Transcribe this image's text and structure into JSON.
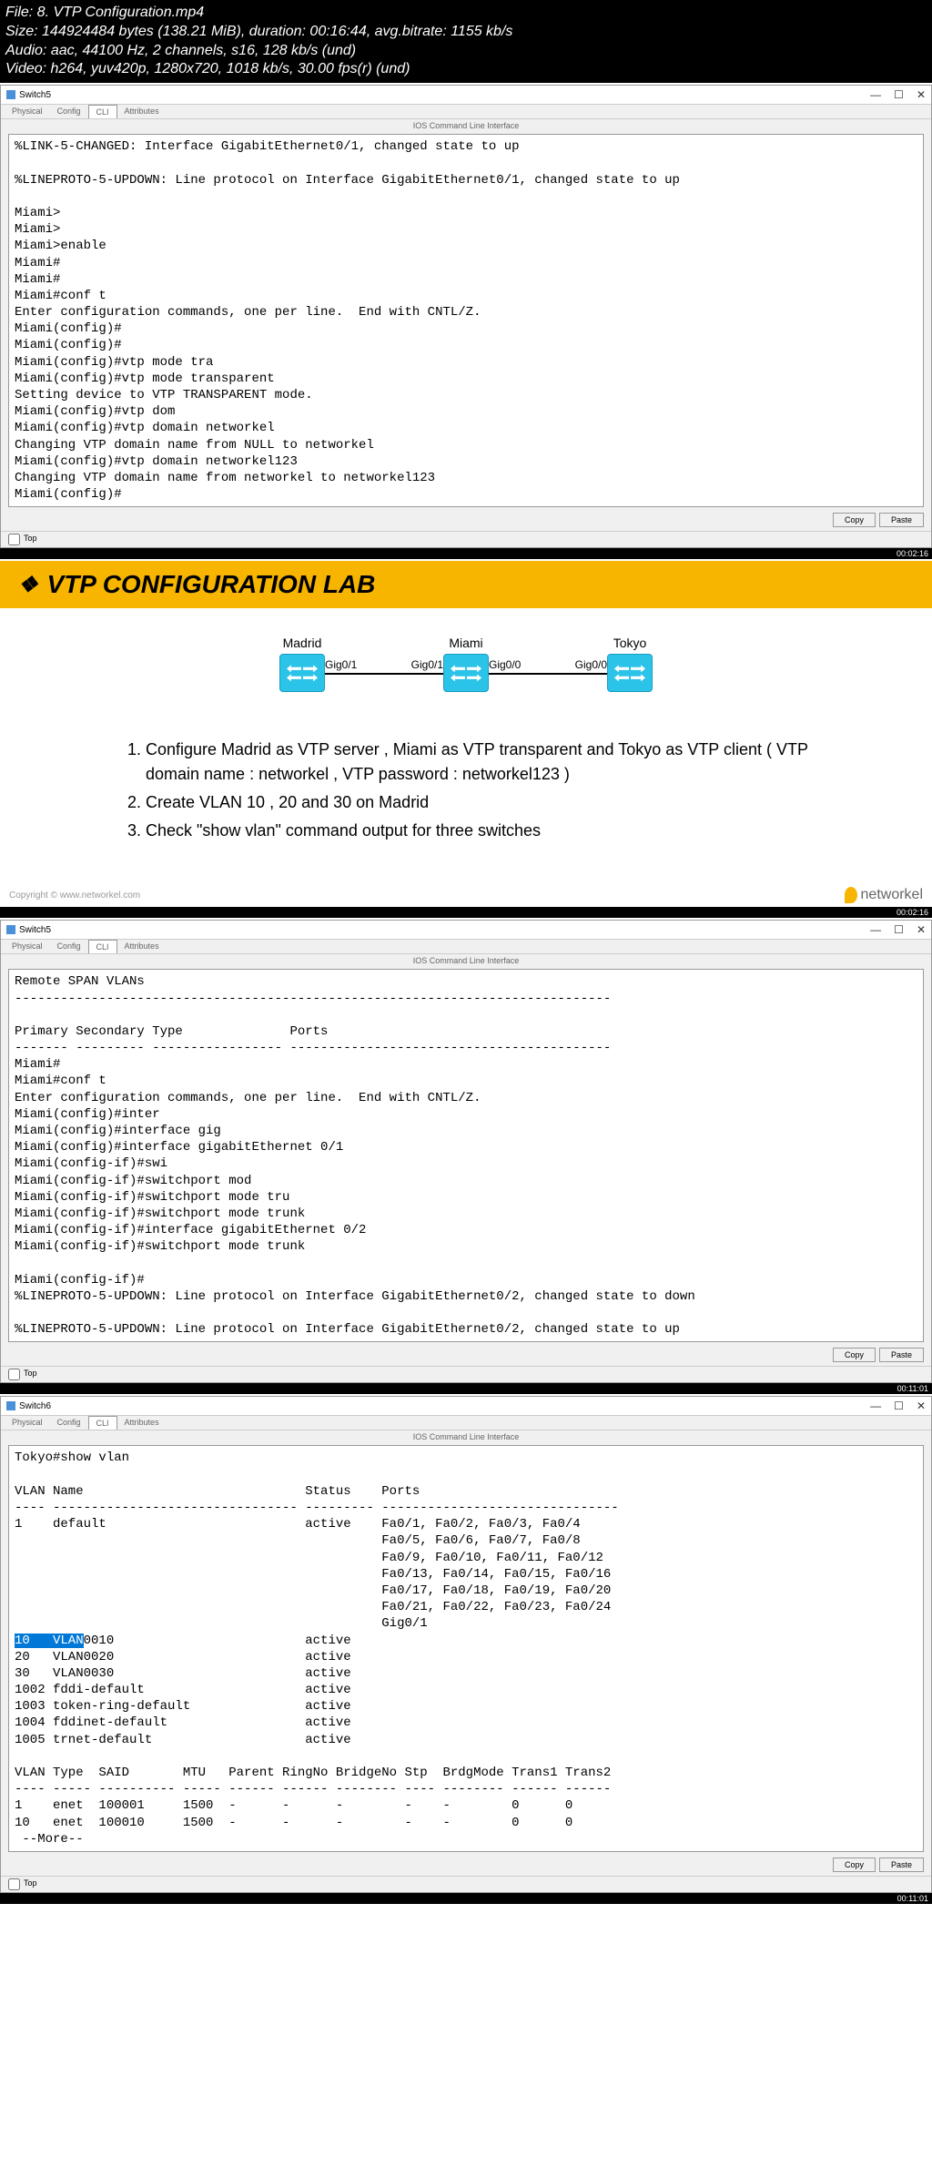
{
  "header": {
    "file": "File: 8. VTP Configuration.mp4",
    "size": "Size: 144924484 bytes (138.21 MiB), duration: 00:16:44, avg.bitrate: 1155 kb/s",
    "audio": "Audio: aac, 44100 Hz, 2 channels, s16, 128 kb/s (und)",
    "video": "Video: h264, yuv420p, 1280x720, 1018 kb/s, 30.00 fps(r) (und)"
  },
  "window1": {
    "title": "Switch5",
    "tabs": [
      "Physical",
      "Config",
      "CLI",
      "Attributes"
    ],
    "cliHeader": "IOS Command Line Interface",
    "cli": "%LINK-5-CHANGED: Interface GigabitEthernet0/1, changed state to up\n\n%LINEPROTO-5-UPDOWN: Line protocol on Interface GigabitEthernet0/1, changed state to up\n\nMiami>\nMiami>\nMiami>enable\nMiami#\nMiami#\nMiami#conf t\nEnter configuration commands, one per line.  End with CNTL/Z.\nMiami(config)#\nMiami(config)#\nMiami(config)#vtp mode tra\nMiami(config)#vtp mode transparent\nSetting device to VTP TRANSPARENT mode.\nMiami(config)#vtp dom\nMiami(config)#vtp domain networkel\nChanging VTP domain name from NULL to networkel\nMiami(config)#vtp domain networkel123\nChanging VTP domain name from networkel to networkel123\nMiami(config)#",
    "copy": "Copy",
    "paste": "Paste",
    "top": "Top"
  },
  "slide": {
    "title": "VTP CONFIGURATION LAB",
    "nodes": {
      "madrid": "Madrid",
      "miami": "Miami",
      "tokyo": "Tokyo"
    },
    "ports": {
      "p1": "Gig0/1",
      "p2": "Gig0/1",
      "p3": "Gig0/0",
      "p4": "Gig0/0"
    },
    "inst1": "Configure Madrid as VTP server , Miami as VTP transparent and Tokyo as VTP client ( VTP domain name : networkel , VTP password : networkel123 )",
    "inst2": "Create VLAN 10 , 20 and 30 on Madrid",
    "inst3": "Check \"show vlan\" command output for three switches",
    "copyright": "Copyright © www.networkel.com",
    "logo": "networkel"
  },
  "window2": {
    "title": "Switch5",
    "cli": "Remote SPAN VLANs\n------------------------------------------------------------------------------\n\nPrimary Secondary Type              Ports\n------- --------- ----------------- ------------------------------------------\nMiami#\nMiami#conf t\nEnter configuration commands, one per line.  End with CNTL/Z.\nMiami(config)#inter\nMiami(config)#interface gig\nMiami(config)#interface gigabitEthernet 0/1\nMiami(config-if)#swi\nMiami(config-if)#switchport mod\nMiami(config-if)#switchport mode tru\nMiami(config-if)#switchport mode trunk\nMiami(config-if)#interface gigabitEthernet 0/2\nMiami(config-if)#switchport mode trunk\n\nMiami(config-if)#\n%LINEPROTO-5-UPDOWN: Line protocol on Interface GigabitEthernet0/2, changed state to down\n\n%LINEPROTO-5-UPDOWN: Line protocol on Interface GigabitEthernet0/2, changed state to up"
  },
  "window3": {
    "title": "Switch6",
    "cli_pre": "Tokyo#show vlan\n\nVLAN Name                             Status    Ports\n---- -------------------------------- --------- -------------------------------\n1    default                          active    Fa0/1, Fa0/2, Fa0/3, Fa0/4\n                                                Fa0/5, Fa0/6, Fa0/7, Fa0/8\n                                                Fa0/9, Fa0/10, Fa0/11, Fa0/12\n                                                Fa0/13, Fa0/14, Fa0/15, Fa0/16\n                                                Fa0/17, Fa0/18, Fa0/19, Fa0/20\n                                                Fa0/21, Fa0/22, Fa0/23, Fa0/24\n                                                Gig0/1\n",
    "cli_hl": "10   VLAN",
    "cli_post": "0010                         active\n20   VLAN0020                         active\n30   VLAN0030                         active\n1002 fddi-default                     active\n1003 token-ring-default               active\n1004 fddinet-default                  active\n1005 trnet-default                    active\n\nVLAN Type  SAID       MTU   Parent RingNo BridgeNo Stp  BrdgMode Trans1 Trans2\n---- ----- ---------- ----- ------ ------ -------- ---- -------- ------ ------\n1    enet  100001     1500  -      -      -        -    -        0      0\n10   enet  100010     1500  -      -      -        -    -        0      0\n --More--"
  }
}
